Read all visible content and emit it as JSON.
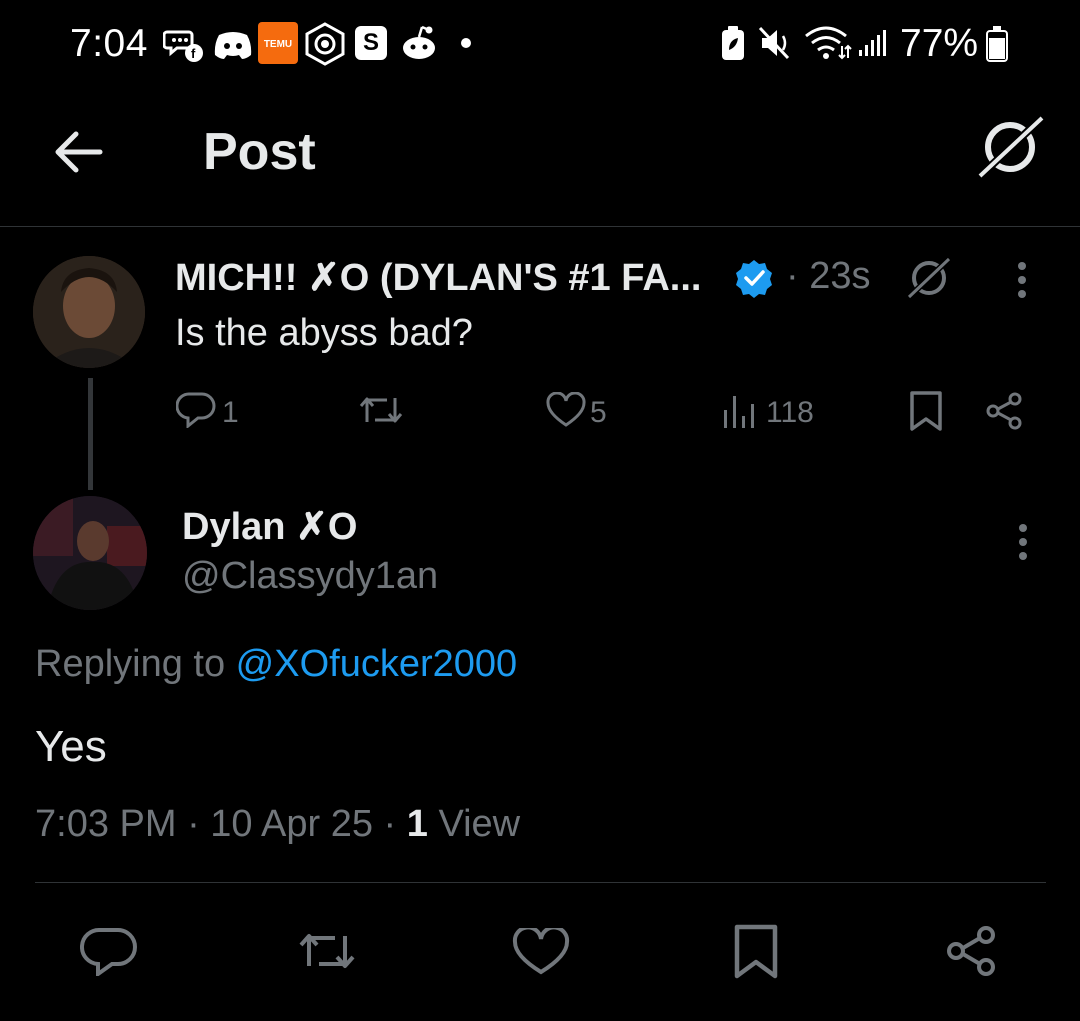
{
  "status_bar": {
    "time": "7:04",
    "battery_percent": "77%",
    "app_icons": [
      "facebook-messenger-icon",
      "discord-icon",
      "temu-icon",
      "lens-app-icon",
      "s-app-icon",
      "reddit-icon",
      "more-dot-icon"
    ],
    "system_icons": [
      "battery-saver-icon",
      "mute-icon",
      "wifi-icon",
      "signal-icon",
      "battery-icon"
    ],
    "temu_badge": "TEMU",
    "s_badge": "S"
  },
  "header": {
    "title": "Post"
  },
  "parent_post": {
    "author_name": "MICH!! ✗O (DYLAN'S #1 FA...",
    "verified": true,
    "time": "· 23s",
    "text": "Is the abyss bad?",
    "replies": "1",
    "likes": "5",
    "views": "118"
  },
  "reply_post": {
    "author_name": "Dylan ✗O",
    "handle": "@Classydy1an",
    "replying_prefix": "Replying to ",
    "replying_handle": "@XOfucker2000",
    "text": "Yes",
    "meta_prefix": "7:03 PM · 10 Apr 25 · ",
    "view_count": "1",
    "view_label": " View"
  },
  "colors": {
    "background": "#000000",
    "text_primary": "#e7e9ea",
    "text_secondary": "#71767b",
    "link": "#1d9bf0",
    "verified": "#1d9bf0",
    "divider": "#2f3336"
  }
}
